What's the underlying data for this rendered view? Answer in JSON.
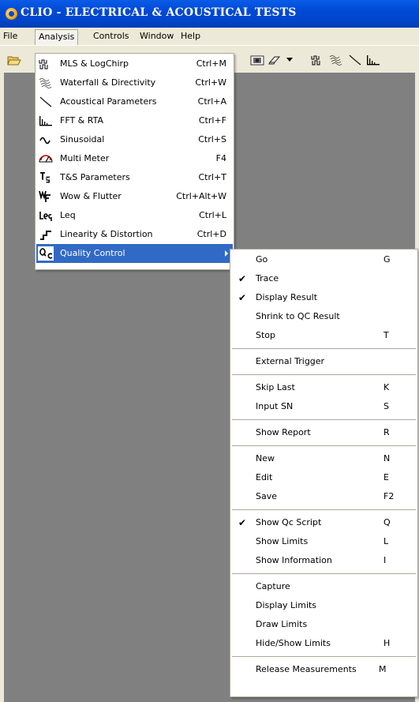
{
  "window": {
    "title": "CLIO - ELECTRICAL & ACOUSTICAL TESTS"
  },
  "menubar": {
    "items": [
      "File",
      "Analysis",
      "Controls",
      "Window",
      "Help"
    ]
  },
  "analysis_menu": {
    "items": [
      {
        "label": "MLS & LogChirp",
        "shortcut": "Ctrl+M",
        "icon": "mls-icon"
      },
      {
        "label": "Waterfall & Directivity",
        "shortcut": "Ctrl+W",
        "icon": "waterfall-icon"
      },
      {
        "label": "Acoustical Parameters",
        "shortcut": "Ctrl+A",
        "icon": "acoustical-icon"
      },
      {
        "label": "FFT & RTA",
        "shortcut": "Ctrl+F",
        "icon": "fft-icon"
      },
      {
        "label": "Sinusoidal",
        "shortcut": "Ctrl+S",
        "icon": "sine-icon"
      },
      {
        "label": "Multi Meter",
        "shortcut": "F4",
        "icon": "meter-icon"
      },
      {
        "label": "T&S Parameters",
        "shortcut": "Ctrl+T",
        "icon": "ts-icon"
      },
      {
        "label": "Wow & Flutter",
        "shortcut": "Ctrl+Alt+W",
        "icon": "wf-icon"
      },
      {
        "label": "Leq",
        "shortcut": "Ctrl+L",
        "icon": "leq-icon"
      },
      {
        "label": "Linearity & Distortion",
        "shortcut": "Ctrl+D",
        "icon": "linearity-icon"
      },
      {
        "label": "Quality Control",
        "shortcut": "",
        "icon": "qc-icon"
      }
    ]
  },
  "qc_submenu": {
    "items": [
      {
        "label": "Go",
        "shortcut": "G",
        "checked": false
      },
      {
        "label": "Trace",
        "shortcut": "",
        "checked": true
      },
      {
        "label": "Display Result",
        "shortcut": "",
        "checked": true
      },
      {
        "label": "Shrink to QC Result",
        "shortcut": "",
        "checked": false
      },
      {
        "label": "Stop",
        "shortcut": "T",
        "checked": false
      },
      {
        "label": "External Trigger",
        "shortcut": "",
        "checked": false
      },
      {
        "label": "Skip Last",
        "shortcut": "K",
        "checked": false
      },
      {
        "label": "Input SN",
        "shortcut": "S",
        "checked": false
      },
      {
        "label": "Show Report",
        "shortcut": "R",
        "checked": false
      },
      {
        "label": "New",
        "shortcut": "N",
        "checked": false
      },
      {
        "label": "Edit",
        "shortcut": "E",
        "checked": false
      },
      {
        "label": "Save",
        "shortcut": "F2",
        "checked": false
      },
      {
        "label": "Show Qc Script",
        "shortcut": "Q",
        "checked": true
      },
      {
        "label": "Show Limits",
        "shortcut": "L",
        "checked": false
      },
      {
        "label": "Show Information",
        "shortcut": "I",
        "checked": false
      },
      {
        "label": "Capture",
        "shortcut": "",
        "checked": false
      },
      {
        "label": "Display Limits",
        "shortcut": "",
        "checked": false
      },
      {
        "label": "Draw Limits",
        "shortcut": "",
        "checked": false
      },
      {
        "label": "Hide/Show Limits",
        "shortcut": "H",
        "checked": false
      },
      {
        "label": "Release Measurements",
        "shortcut": "M",
        "checked": false
      }
    ]
  }
}
